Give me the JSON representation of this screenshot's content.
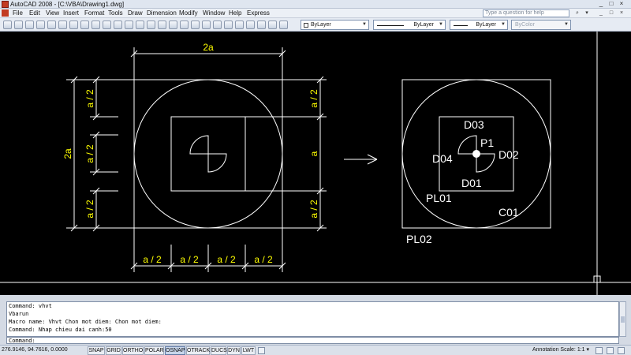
{
  "window": {
    "title": "AutoCAD 2008 - [C:\\VBA\\Drawing1.dwg]",
    "controls": [
      "_",
      "□",
      "×"
    ]
  },
  "menu": {
    "items": [
      "File",
      "Edit",
      "View",
      "Insert",
      "Format",
      "Tools",
      "Draw",
      "Dimension",
      "Modify",
      "Window",
      "Help",
      "Express"
    ],
    "search_placeholder": "Type a question for help",
    "doc_controls": [
      "_",
      "□",
      "×"
    ]
  },
  "toolbar": {
    "layer_color": "ByLayer",
    "layer_linetype": "ByLayer",
    "layer_lineweight": "ByLayer",
    "plot_style": "ByColor"
  },
  "drawing": {
    "colors": {
      "white": "#ffffff",
      "yellow": "#ffff00",
      "background": "#000000"
    },
    "left": {
      "top_dim": "2a",
      "left_outer_dim": "2a",
      "left_dims": [
        "a / 2",
        "a / 2",
        "a / 2"
      ],
      "right_dims": [
        "a / 2",
        "a",
        "a / 2"
      ],
      "bottom_dims": [
        "a / 2",
        "a / 2",
        "a / 2",
        "a / 2"
      ]
    },
    "right": {
      "labels": {
        "d03": "D03",
        "p1": "P1",
        "d04": "D04",
        "d02": "D02",
        "d01": "D01",
        "pl01": "PL01",
        "c01": "C01",
        "pl02": "PL02"
      }
    }
  },
  "command": {
    "history": [
      "Command: vhvt",
      "Vbarun",
      "Macro name: Vhvt Chon mot diem: Chon mot diem:",
      "Command: Nhap chieu dai canh:50"
    ],
    "prompt": "Command:"
  },
  "status": {
    "coordinates": "276.9146, 94.7616, 0.0000",
    "toggles": [
      {
        "label": "SNAP",
        "on": false
      },
      {
        "label": "GRID",
        "on": false
      },
      {
        "label": "ORTHO",
        "on": false
      },
      {
        "label": "POLAR",
        "on": false
      },
      {
        "label": "OSNAP",
        "on": true
      },
      {
        "label": "OTRACK",
        "on": false
      },
      {
        "label": "DUCS",
        "on": false
      },
      {
        "label": "DYN",
        "on": false
      },
      {
        "label": "LWT",
        "on": false
      }
    ],
    "annotation_scale_label": "Annotation Scale:",
    "annotation_scale_value": "1:1"
  }
}
